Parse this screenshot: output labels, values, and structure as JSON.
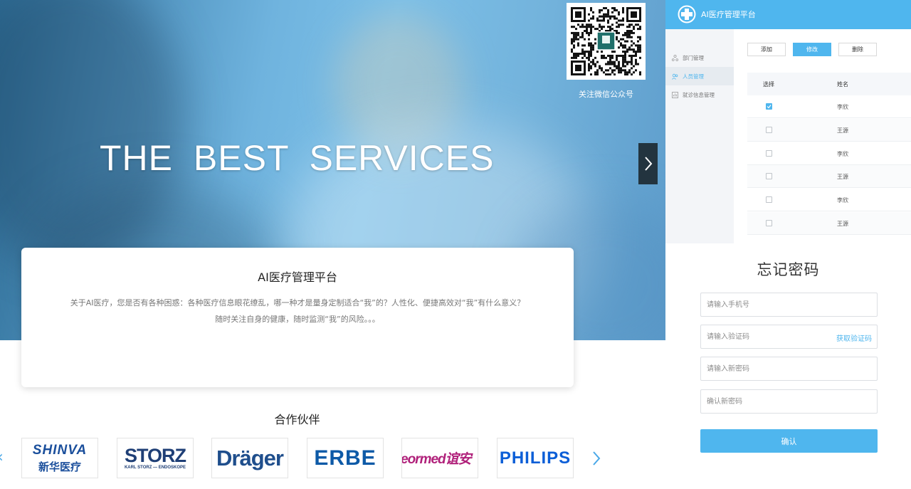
{
  "hero": {
    "title": "THE  BEST  SERVICES"
  },
  "qr": {
    "label": "关注微信公众号"
  },
  "intro": {
    "title": "AI医疗管理平台",
    "line1": "关于AI医疗，您是否有各种困惑：各种医疗信息眼花缭乱，哪一种才是量身定制适合“我”的？人性化、便捷高效对“我”有什么意义？",
    "line2": "随时关注自身的健康，随时监测“我”的风险。。。"
  },
  "partners": {
    "title": "合作伙伴",
    "logos": [
      {
        "line1": "SHINVA",
        "line2": "新华医疗",
        "color": "#1b4f9c"
      },
      {
        "line1": "STORZ",
        "line2": "KARL STORZ — ENDOSKOPE",
        "color": "#1f3f76"
      },
      {
        "line1": "Dräger",
        "color": "#1f4e8c"
      },
      {
        "line1": "ERBE",
        "color": "#0e5aa7"
      },
      {
        "line1": "eormed谊安",
        "color": "#b0207a"
      },
      {
        "line1": "PHILIPS",
        "color": "#0b5ed7"
      }
    ]
  },
  "admin": {
    "title": "AI医疗管理平台",
    "sidebar": [
      {
        "label": "部门管理",
        "active": false
      },
      {
        "label": "人员管理",
        "active": true
      },
      {
        "label": "就诊信息管理",
        "active": false
      }
    ],
    "buttons": {
      "add": "添加",
      "edit": "修改",
      "delete": "删除"
    },
    "columns": [
      "选择",
      "姓名"
    ],
    "rows": [
      {
        "checked": true,
        "name": "李欣"
      },
      {
        "checked": false,
        "name": "王源"
      },
      {
        "checked": false,
        "name": "李欣"
      },
      {
        "checked": false,
        "name": "王源"
      },
      {
        "checked": false,
        "name": "李欣"
      },
      {
        "checked": false,
        "name": "王源"
      }
    ],
    "accent": "#4fb6ee"
  },
  "forgot": {
    "title": "忘记密码",
    "phone_placeholder": "请输入手机号",
    "code_placeholder": "请输入验证码",
    "get_code": "获取验证码",
    "new_pwd_placeholder": "请输入新密码",
    "confirm_pwd_placeholder": "确认新密码",
    "submit": "确认"
  }
}
